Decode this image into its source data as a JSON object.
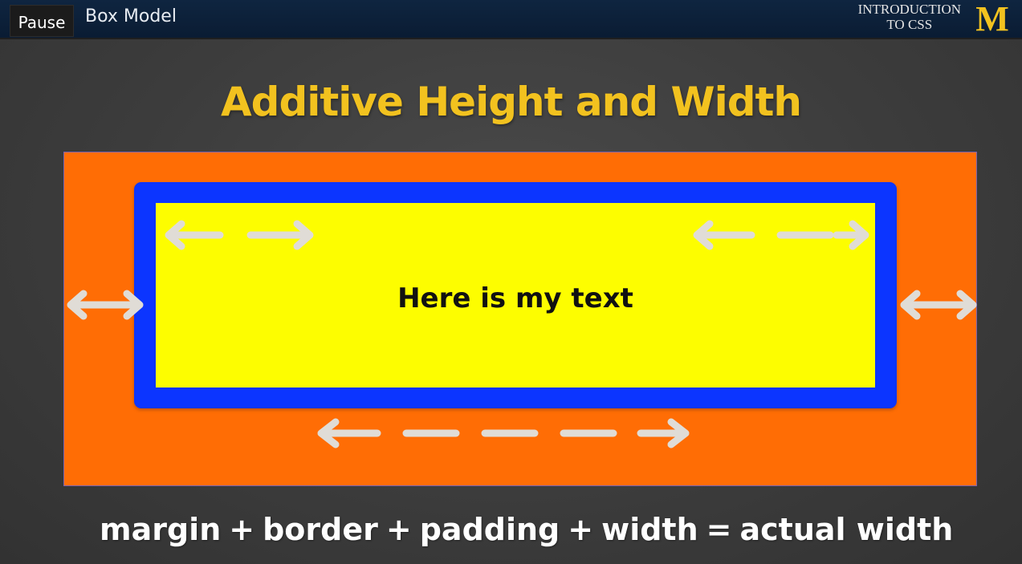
{
  "header": {
    "pause_label": "Pause",
    "lesson_title": "Box Model",
    "course_line1": "INTRODUCTION",
    "course_line2": "TO CSS",
    "logo_letter": "M"
  },
  "slide": {
    "title": "Additive Height and Width",
    "content_text": "Here is my text",
    "formula": {
      "term1": "margin",
      "op1": "+",
      "term2": "border",
      "op2": "+",
      "term3": "padding",
      "op3": "+",
      "term4": "width",
      "eq": "=",
      "result": "actual width"
    }
  },
  "colors": {
    "margin": "#ff6d05",
    "border": "#0c35ff",
    "content": "#fdfd00",
    "title": "#f2c21f",
    "arrow": "#e0dcd6",
    "logo": "#f2c21f"
  },
  "icons": {
    "padding_left": "left-right-arrow-icon",
    "padding_right": "left-right-dashed-arrow-icon",
    "margin_left": "double-arrow-icon",
    "margin_right": "double-arrow-icon",
    "width": "left-right-dashed-arrow-icon",
    "logo": "michigan-m-icon"
  }
}
